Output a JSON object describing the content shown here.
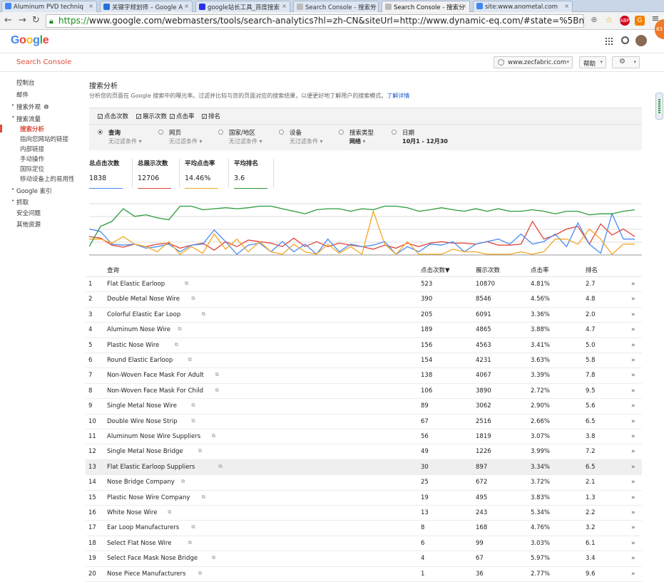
{
  "browser": {
    "tabs": [
      {
        "label": "Aluminum PVD techniq",
        "icon_color": "#4285f4",
        "active": false
      },
      {
        "label": "关键字规划师 – Google A",
        "icon_color": "#2a6fdb",
        "active": false
      },
      {
        "label": "google站长工具_百度搜索",
        "icon_color": "#2932e1",
        "active": false
      },
      {
        "label": "Search Console - 搜索分",
        "icon_color": "#bbbbbb",
        "active": false
      },
      {
        "label": "Search Console - 搜索分",
        "icon_color": "#bbbbbb",
        "active": true
      },
      {
        "label": "site:www.anometal.com",
        "icon_color": "#4285f4",
        "active": false
      }
    ],
    "url_scheme": "https://",
    "url_rest": "www.google.com/webmasters/tools/search-analytics?hl=zh-CN&siteUrl=http://www.dynamic-eq.com/#state=%5Bnull%2C%5B%",
    "badge_count": "83",
    "abp_label": "ABP"
  },
  "header": {
    "logo": "Google",
    "logo_colors": [
      "#4285f4",
      "#ea4335",
      "#fbbc05",
      "#4285f4",
      "#34a853",
      "#ea4335"
    ]
  },
  "console": {
    "title": "Search Console",
    "site": "www.zecfabric.com",
    "help": "帮助",
    "settings_caret": "▾"
  },
  "sidebar": {
    "items": [
      {
        "label": "控制台",
        "level": 0
      },
      {
        "label": "邮件",
        "level": 0
      },
      {
        "label": "搜索外观",
        "level": 0,
        "arrow": "▸",
        "info": "❶"
      },
      {
        "label": "搜索流量",
        "level": 0,
        "arrow": "▾"
      },
      {
        "label": "搜索分析",
        "level": 1,
        "active": true
      },
      {
        "label": "指向您网站的链接",
        "level": 1
      },
      {
        "label": "内部链接",
        "level": 1
      },
      {
        "label": "手动操作",
        "level": 1
      },
      {
        "label": "国际定位",
        "level": 1
      },
      {
        "label": "移动设备上的易用性",
        "level": 1
      },
      {
        "label": "Google 索引",
        "level": 0,
        "arrow": "▸"
      },
      {
        "label": "抓取",
        "level": 0,
        "arrow": "▸"
      },
      {
        "label": "安全问题",
        "level": 0
      },
      {
        "label": "其他资源",
        "level": 0
      }
    ]
  },
  "page": {
    "title": "搜索分析",
    "description": "分析您的页面在 Google 搜索中的曝光率。过滤并比较与您的页面对应的搜索结果，以便更好地了解用户的搜索模式。",
    "learn_more": "了解详情",
    "checkboxes": [
      "点击次数",
      "展示次数",
      "点击率",
      "排名"
    ],
    "check_mark": "✓",
    "filters": [
      {
        "label": "查询",
        "sub": "无过滤条件",
        "selected": true
      },
      {
        "label": "网页",
        "sub": "无过滤条件",
        "selected": false
      },
      {
        "label": "国家/地区",
        "sub": "无过滤条件",
        "selected": false
      },
      {
        "label": "设备",
        "sub": "无过滤条件",
        "selected": false
      },
      {
        "label": "搜索类型",
        "sub": "网络",
        "selected": false
      },
      {
        "label": "日期",
        "sub": "10月1 - 12月30",
        "selected": false
      }
    ],
    "metrics": [
      {
        "label": "总点击次数",
        "value": "1838",
        "color": "#4a8cf0"
      },
      {
        "label": "总展示次数",
        "value": "12706",
        "color": "#e0463a"
      },
      {
        "label": "平均点击率",
        "value": "14.46%",
        "color": "#f5a623"
      },
      {
        "label": "平均排名",
        "value": "3.6",
        "color": "#2a9a3a"
      }
    ]
  },
  "chart_data": {
    "type": "line",
    "series": [
      {
        "name": "总展示次数",
        "color": "#e0463a",
        "values": [
          0.35,
          0.32,
          0.18,
          0.14,
          0.2,
          0.15,
          0.2,
          0.22,
          0.12,
          0.18,
          0.22,
          0.08,
          0.25,
          0.15,
          0.28,
          0.25,
          0.22,
          0.15,
          0.32,
          0.15,
          0.25,
          0.15,
          0.22,
          0.18,
          0.15,
          0.1,
          0.18,
          0.12,
          0.22,
          0.15,
          0.22,
          0.25,
          0.22,
          0.22,
          0.2,
          0.25,
          0.18,
          0.18,
          0.2,
          0.65,
          0.3,
          0.38,
          0.5,
          0.55,
          0.2,
          0.6,
          0.38,
          0.5,
          0.35
        ]
      },
      {
        "name": "总点击次数",
        "color": "#4a8cf0",
        "values": [
          0.5,
          0.45,
          0.2,
          0.18,
          0.2,
          0.12,
          0.15,
          0.2,
          0.05,
          0.18,
          0.2,
          0.48,
          0.25,
          0.0,
          0.18,
          0.22,
          0.05,
          0.25,
          0.05,
          0.2,
          0.0,
          0.3,
          0.05,
          0.2,
          0.15,
          0.18,
          0.25,
          0.0,
          0.15,
          0.05,
          0.2,
          0.18,
          0.25,
          0.05,
          0.2,
          0.25,
          0.3,
          0.2,
          0.4,
          0.2,
          0.25,
          0.4,
          0.15,
          0.62,
          0.2,
          0.02,
          0.8,
          0.3,
          0.3
        ]
      },
      {
        "name": "平均点击率",
        "color": "#f5a623",
        "values": [
          0.3,
          0.3,
          0.22,
          0.35,
          0.2,
          0.15,
          0.05,
          0.25,
          0.0,
          0.15,
          0.02,
          0.4,
          0.1,
          0.3,
          0.05,
          0.25,
          0.05,
          0.0,
          0.2,
          0.05,
          0.0,
          0.2,
          0.02,
          0.15,
          0.0,
          0.85,
          0.2,
          0.0,
          0.25,
          0.0,
          0.0,
          0.0,
          0.1,
          0.05,
          0.05,
          0.0,
          0.0,
          0.0,
          0.05,
          0.0,
          0.05,
          0.3,
          0.3,
          0.2,
          0.5,
          0.3,
          0.0,
          0.2,
          0.2
        ]
      },
      {
        "name": "平均排名",
        "color": "#2a9a3a",
        "values": [
          0.15,
          0.55,
          0.65,
          0.9,
          0.75,
          0.78,
          0.72,
          0.68,
          0.95,
          0.95,
          0.88,
          0.9,
          0.92,
          0.9,
          0.92,
          0.95,
          0.95,
          0.9,
          0.85,
          0.8,
          0.88,
          0.9,
          0.9,
          0.85,
          0.9,
          0.88,
          0.95,
          0.95,
          0.92,
          0.85,
          0.88,
          0.92,
          0.88,
          0.85,
          0.9,
          0.85,
          0.9,
          0.85,
          0.85,
          0.88,
          0.85,
          0.8,
          0.85,
          0.85,
          0.78,
          0.8,
          0.8,
          0.85,
          0.88
        ]
      }
    ]
  },
  "table": {
    "headers": {
      "query": "查询",
      "clicks": "点击次数▼",
      "impressions": "展示次数",
      "ctr": "点击率",
      "position": "排名"
    },
    "ext_icon": "⧉",
    "chevron": "»",
    "rows": [
      {
        "n": "1",
        "q": "Flat Elastic Earloop",
        "c": "523",
        "i": "10870",
        "ctr": "4.81%",
        "p": "2.7"
      },
      {
        "n": "2",
        "q": "Double Metal Nose Wire",
        "c": "390",
        "i": "8546",
        "ctr": "4.56%",
        "p": "4.8"
      },
      {
        "n": "3",
        "q": "Colorful Elastic Ear Loop",
        "c": "205",
        "i": "6091",
        "ctr": "3.36%",
        "p": "2.0"
      },
      {
        "n": "4",
        "q": "Aluminum Nose Wire",
        "c": "189",
        "i": "4865",
        "ctr": "3.88%",
        "p": "4.7"
      },
      {
        "n": "5",
        "q": "Plastic Nose Wire",
        "c": "156",
        "i": "4563",
        "ctr": "3.41%",
        "p": "5.0"
      },
      {
        "n": "6",
        "q": "Round Elastic Earloop",
        "c": "154",
        "i": "4231",
        "ctr": "3.63%",
        "p": "5.8"
      },
      {
        "n": "7",
        "q": "Non-Woven Face Mask For Adult",
        "c": "138",
        "i": "4067",
        "ctr": "3.39%",
        "p": "7.8"
      },
      {
        "n": "8",
        "q": "Non-Woven Face Mask For Child",
        "c": "106",
        "i": "3890",
        "ctr": "2.72%",
        "p": "9.5"
      },
      {
        "n": "9",
        "q": "Single Metal Nose Wire",
        "c": "89",
        "i": "3062",
        "ctr": "2.90%",
        "p": "5.6"
      },
      {
        "n": "10",
        "q": "Double Wire Nose Strip",
        "c": "67",
        "i": "2516",
        "ctr": "2.66%",
        "p": "6.5"
      },
      {
        "n": "11",
        "q": "Aluminum Nose Wire Suppliers",
        "c": "56",
        "i": "1819",
        "ctr": "3.07%",
        "p": "3.8"
      },
      {
        "n": "12",
        "q": "Single Metal Nose Bridge",
        "c": "49",
        "i": "1226",
        "ctr": "3.99%",
        "p": "7.2"
      },
      {
        "n": "13",
        "q": "Flat Elastic Earloop Suppliers",
        "c": "30",
        "i": "897",
        "ctr": "3.34%",
        "p": "6.5",
        "hl": true
      },
      {
        "n": "14",
        "q": "Nose Bridge Company",
        "c": "25",
        "i": "672",
        "ctr": "3.72%",
        "p": "2.1"
      },
      {
        "n": "15",
        "q": "Plastic Nose Wire Company",
        "c": "19",
        "i": "495",
        "ctr": "3.83%",
        "p": "1.3"
      },
      {
        "n": "16",
        "q": "White Nose Wire",
        "c": "13",
        "i": "243",
        "ctr": "5.34%",
        "p": "2.2"
      },
      {
        "n": "17",
        "q": "Ear Loop Manufacturers",
        "c": "8",
        "i": "168",
        "ctr": "4.76%",
        "p": "3.2"
      },
      {
        "n": "18",
        "q": "Select Flat Nose Wire",
        "c": "6",
        "i": "99",
        "ctr": "3.03%",
        "p": "6.1"
      },
      {
        "n": "19",
        "q": "Select Face Mask Nose Bridge",
        "c": "4",
        "i": "67",
        "ctr": "5.97%",
        "p": "3.4"
      },
      {
        "n": "20",
        "q": "Nose Piece Manufacturers",
        "c": "1",
        "i": "36",
        "ctr": "2.77%",
        "p": "9.6"
      }
    ]
  }
}
